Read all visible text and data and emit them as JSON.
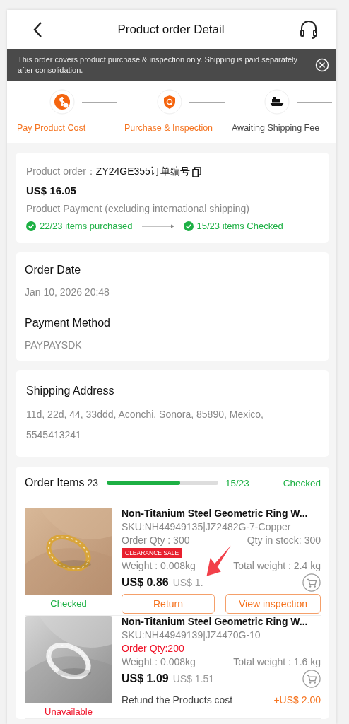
{
  "header": {
    "title": "Product order Detail"
  },
  "notice": {
    "text": "This order covers product purchase & inspection only. Shipping is paid separately after consolidation."
  },
  "steps": [
    {
      "label": "Pay Product Cost",
      "kind": "pay",
      "done": true
    },
    {
      "label": "Purchase & Inspection",
      "kind": "inspect",
      "done": true
    },
    {
      "label": "Awaiting Shipping Fee",
      "kind": "ship",
      "done": false
    }
  ],
  "summary": {
    "order_label": "Product order：",
    "order_no": "ZY24GE355订单编号",
    "amount": "US$ 16.05",
    "note": "Product Payment (excluding international shipping)",
    "progress": [
      "22/23 items purchased",
      "15/23 items Checked"
    ]
  },
  "order_info": [
    {
      "label": "Order Date",
      "value": "Jan 10, 2026 20:48"
    },
    {
      "label": "Payment Method",
      "value": "PAYPAYSDK"
    }
  ],
  "shipping": {
    "title": "Shipping Address",
    "address": "11d, 22d, 44, 33ddd, Aconchi, Sonora, 85890, Mexico, 5545413241"
  },
  "items_section": {
    "title": "Order Items",
    "count": "23",
    "level": 0.66,
    "checked_count": "15/23",
    "checked_label": "Checked"
  },
  "items": [
    {
      "name": "Non-Titanium Steel Geometric Ring W...",
      "sku": "SKU:NH44949135|JZ2482G-7-Copper",
      "qty": "Order Qty : 300",
      "qty_alert": false,
      "stock": "Qty in stock: 300",
      "tag": "CLEARANCE SALE",
      "weight": "Weight : 0.008kg",
      "total_weight": "Total weight : 2.4 kg",
      "price": "US$ 0.86",
      "old_price": "US$ 1.",
      "status": "Checked",
      "status_ok": true,
      "actions": [
        "Return",
        "View inspection"
      ]
    },
    {
      "name": "Non-Titanium Steel Geometric Ring W...",
      "sku": "SKU:NH44949139|JZ4470G-10",
      "qty": "Order Qty:200",
      "qty_alert": true,
      "weight": "Weight : 0.008kg",
      "total_weight": "Total weight : 1.6 kg",
      "price": "US$ 1.09",
      "old_price": "US$ 1.51",
      "status": "Unavailable",
      "status_ok": false,
      "refund_label": "Refund the Products cost",
      "refund_amount": "+US$ 2.00"
    }
  ]
}
